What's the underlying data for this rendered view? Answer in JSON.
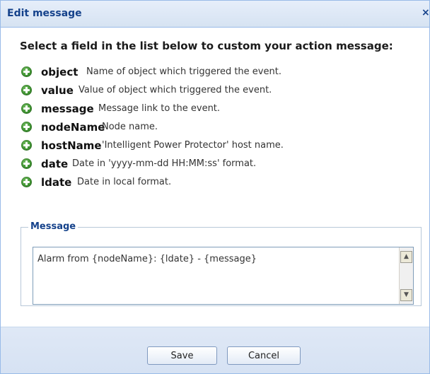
{
  "dialog": {
    "title": "Edit message",
    "close_icon": "close-icon",
    "close_symbol": "×"
  },
  "intro": {
    "text": "Select a field in the list below to custom your action message:"
  },
  "fields": [
    {
      "name": "object",
      "description": "Name of object which triggered the event."
    },
    {
      "name": "value",
      "description": "Value of object which triggered the event."
    },
    {
      "name": "message",
      "description": "Message link to the event."
    },
    {
      "name": "nodeName",
      "description": "Node name."
    },
    {
      "name": "hostName",
      "description": "'Intelligent Power Protector' host name."
    },
    {
      "name": "date",
      "description": "Date in 'yyyy-mm-dd HH:MM:ss' format."
    },
    {
      "name": "ldate",
      "description": "Date in local format."
    }
  ],
  "message_group": {
    "legend": "Message",
    "value": "Alarm from {nodeName}: {ldate} - {message}"
  },
  "scrollbar": {
    "up_symbol": "▲",
    "down_symbol": "▼"
  },
  "buttons": {
    "save_label": "Save",
    "cancel_label": "Cancel"
  },
  "colors": {
    "title": "#15428b",
    "add_icon": "#3f9332",
    "footer": "#dfe8f6"
  }
}
